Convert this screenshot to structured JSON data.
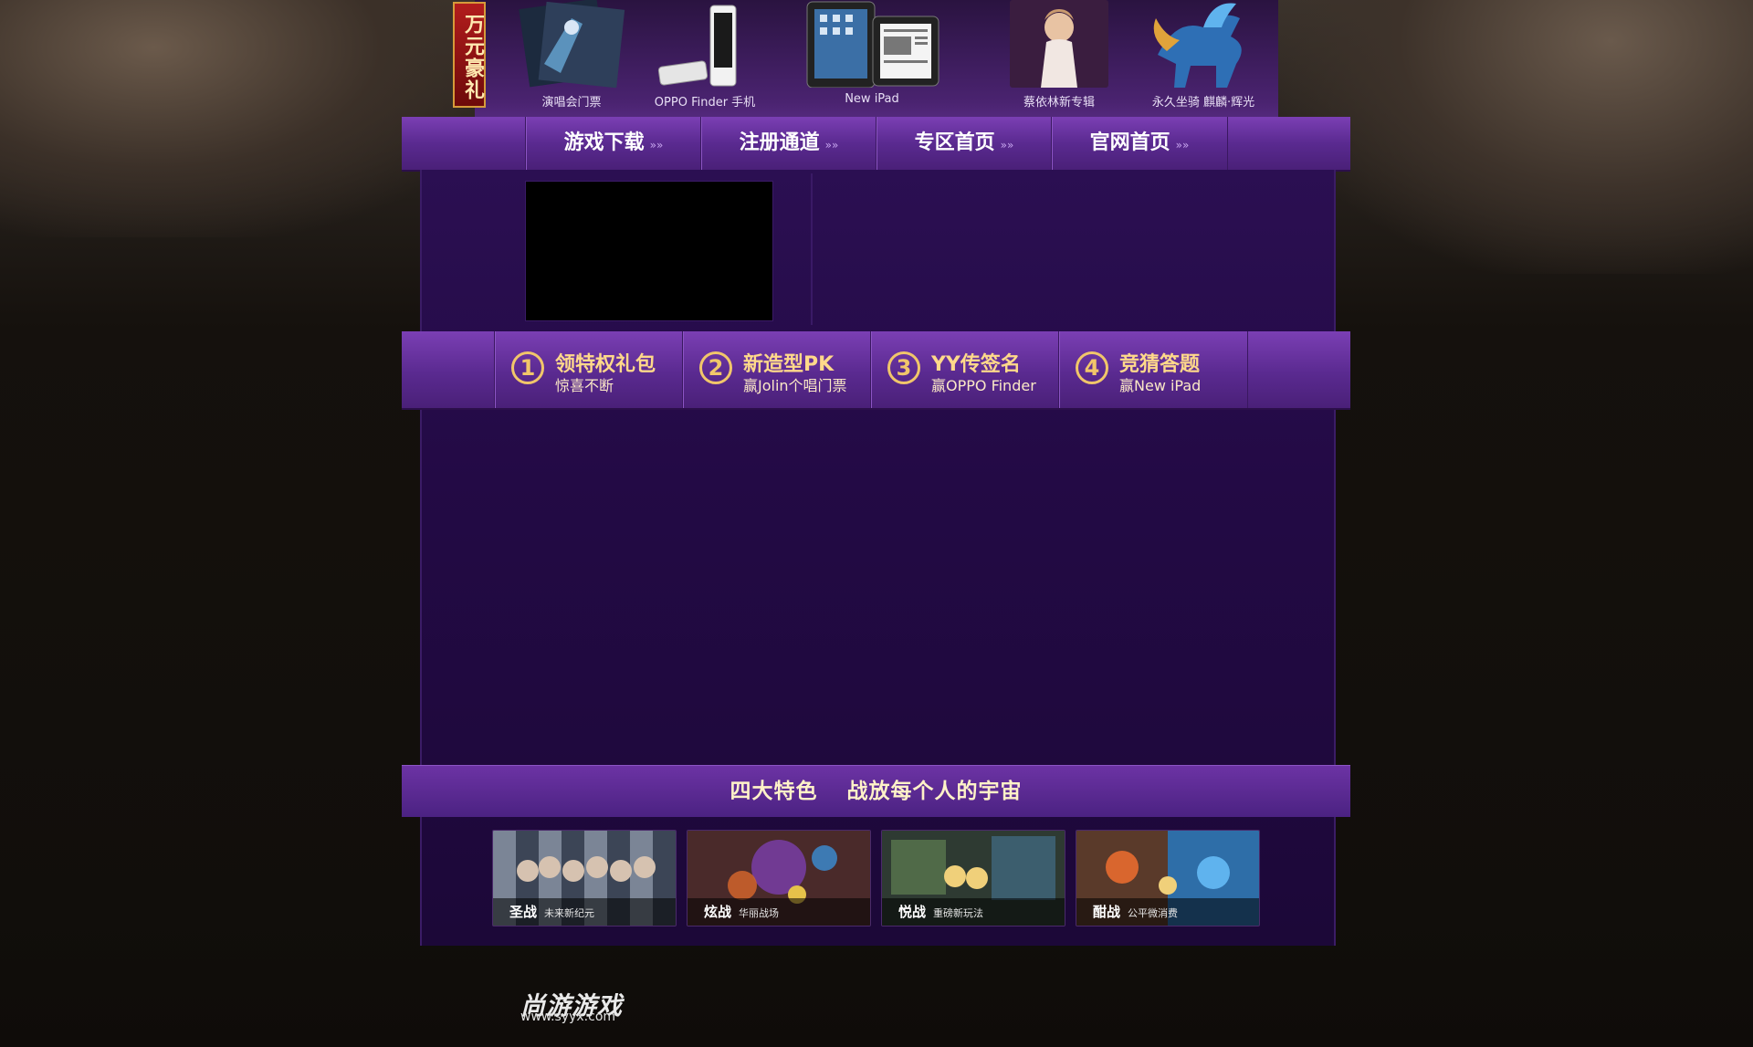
{
  "prize": {
    "badge": "万元豪礼",
    "items": [
      {
        "label": "演唱会门票"
      },
      {
        "label": "OPPO Finder 手机"
      },
      {
        "label": "New iPad"
      },
      {
        "label": "蔡依林新专辑"
      },
      {
        "label": "永久坐骑 麒麟·辉光"
      }
    ]
  },
  "nav": {
    "items": [
      {
        "label": "游戏下载",
        "arrows": "»»"
      },
      {
        "label": "注册通道",
        "arrows": "»»"
      },
      {
        "label": "专区首页",
        "arrows": "»»"
      },
      {
        "label": "官网首页",
        "arrows": "»»"
      }
    ]
  },
  "steps": [
    {
      "num": "1",
      "title": "领特权礼包",
      "sub": "惊喜不断"
    },
    {
      "num": "2",
      "title": "新造型PK",
      "sub": "赢Jolin个唱门票"
    },
    {
      "num": "3",
      "title": "YY传签名",
      "sub": "赢OPPO Finder"
    },
    {
      "num": "4",
      "title": "竞猜答题",
      "sub": "赢New iPad"
    }
  ],
  "features": {
    "title_left": "四大特色",
    "title_right": "战放每个人的宇宙",
    "cards": [
      {
        "name": "圣战",
        "desc": "未来新纪元"
      },
      {
        "name": "炫战",
        "desc": "华丽战场"
      },
      {
        "name": "悦战",
        "desc": "重磅新玩法"
      },
      {
        "name": "酣战",
        "desc": "公平微消费"
      }
    ]
  },
  "footer": {
    "logo": "尚游游戏",
    "url": "www.syyx.com"
  },
  "colors": {
    "nav_purple": "#5a2a90",
    "panel_purple": "#230a45",
    "gold": "#ffd98a"
  }
}
